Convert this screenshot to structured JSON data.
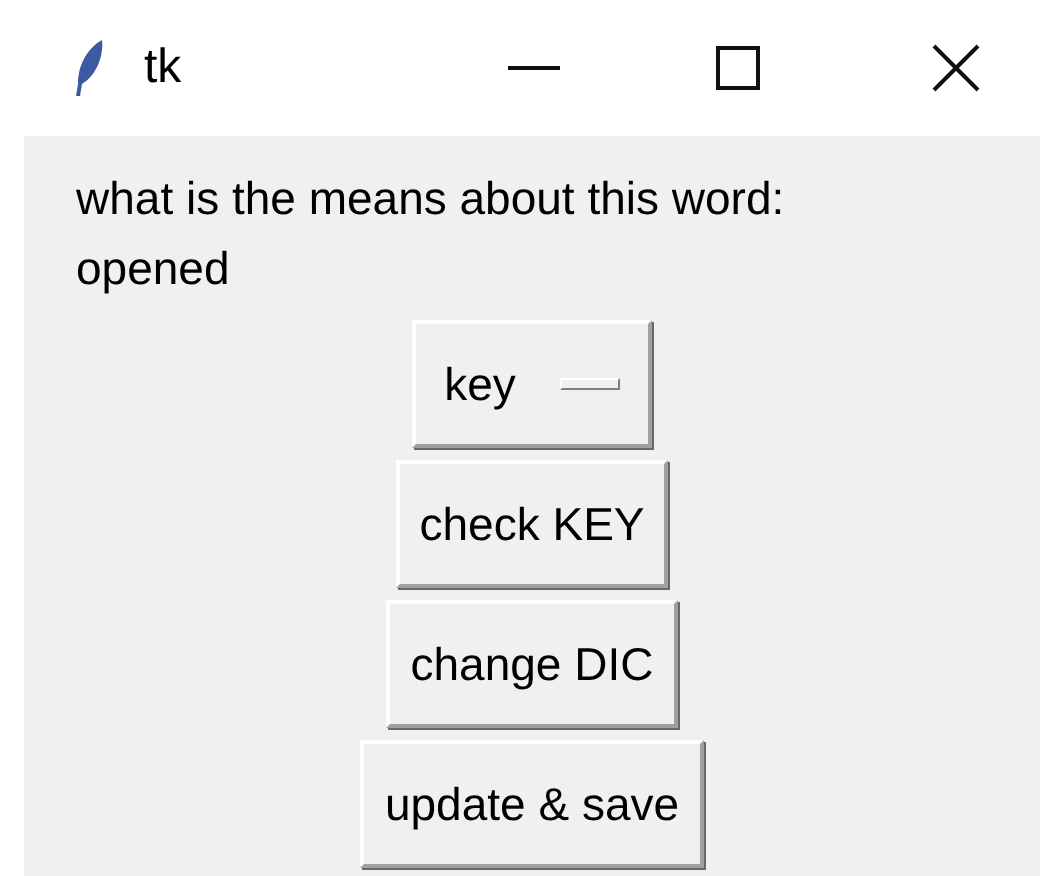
{
  "window": {
    "title": "tk"
  },
  "prompt_lines": [
    "what is the means about this word:",
    "opened"
  ],
  "option_menu": {
    "value": "key"
  },
  "buttons": [
    "check KEY",
    "change DIC",
    "update & save"
  ]
}
